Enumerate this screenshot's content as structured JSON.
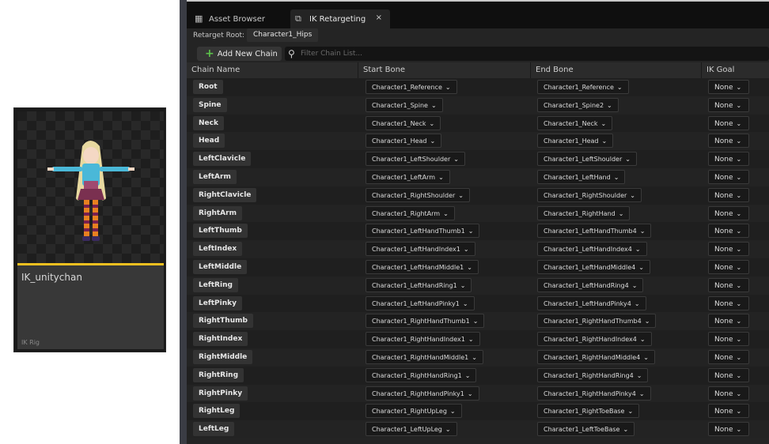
{
  "asset": {
    "name": "IK_unitychan",
    "type": "IK Rig"
  },
  "tabs": [
    {
      "label": "Asset Browser",
      "icon": "folder-icon"
    },
    {
      "label": "IK Retargeting",
      "icon": "retarget-icon",
      "close": "×"
    }
  ],
  "retarget_root": {
    "label": "Retarget Root:",
    "value": "Character1_Hips"
  },
  "toolbar": {
    "add_chain_label": "Add New Chain",
    "search_placeholder": "Filter Chain List..."
  },
  "columns": {
    "name": "Chain Name",
    "start": "Start Bone",
    "end": "End Bone",
    "goal": "IK Goal"
  },
  "chains": [
    {
      "name": "Root",
      "start": "Character1_Reference",
      "end": "Character1_Reference",
      "goal": "None"
    },
    {
      "name": "Spine",
      "start": "Character1_Spine",
      "end": "Character1_Spine2",
      "goal": "None"
    },
    {
      "name": "Neck",
      "start": "Character1_Neck",
      "end": "Character1_Neck",
      "goal": "None"
    },
    {
      "name": "Head",
      "start": "Character1_Head",
      "end": "Character1_Head",
      "goal": "None"
    },
    {
      "name": "LeftClavicle",
      "start": "Character1_LeftShoulder",
      "end": "Character1_LeftShoulder",
      "goal": "None"
    },
    {
      "name": "LeftArm",
      "start": "Character1_LeftArm",
      "end": "Character1_LeftHand",
      "goal": "None"
    },
    {
      "name": "RightClavicle",
      "start": "Character1_RightShoulder",
      "end": "Character1_RightShoulder",
      "goal": "None"
    },
    {
      "name": "RightArm",
      "start": "Character1_RightArm",
      "end": "Character1_RightHand",
      "goal": "None"
    },
    {
      "name": "LeftThumb",
      "start": "Character1_LeftHandThumb1",
      "end": "Character1_LeftHandThumb4",
      "goal": "None"
    },
    {
      "name": "LeftIndex",
      "start": "Character1_LeftHandIndex1",
      "end": "Character1_LeftHandIndex4",
      "goal": "None"
    },
    {
      "name": "LeftMiddle",
      "start": "Character1_LeftHandMiddle1",
      "end": "Character1_LeftHandMiddle4",
      "goal": "None"
    },
    {
      "name": "LeftRing",
      "start": "Character1_LeftHandRing1",
      "end": "Character1_LeftHandRing4",
      "goal": "None"
    },
    {
      "name": "LeftPinky",
      "start": "Character1_LeftHandPinky1",
      "end": "Character1_LeftHandPinky4",
      "goal": "None"
    },
    {
      "name": "RightThumb",
      "start": "Character1_RightHandThumb1",
      "end": "Character1_RightHandThumb4",
      "goal": "None"
    },
    {
      "name": "RightIndex",
      "start": "Character1_RightHandIndex1",
      "end": "Character1_RightHandIndex4",
      "goal": "None"
    },
    {
      "name": "RightMiddle",
      "start": "Character1_RightHandMiddle1",
      "end": "Character1_RightHandMiddle4",
      "goal": "None"
    },
    {
      "name": "RightRing",
      "start": "Character1_RightHandRing1",
      "end": "Character1_RightHandRing4",
      "goal": "None"
    },
    {
      "name": "RightPinky",
      "start": "Character1_RightHandPinky1",
      "end": "Character1_RightHandPinky4",
      "goal": "None"
    },
    {
      "name": "RightLeg",
      "start": "Character1_RightUpLeg",
      "end": "Character1_RightToeBase",
      "goal": "None"
    },
    {
      "name": "LeftLeg",
      "start": "Character1_LeftUpLeg",
      "end": "Character1_LeftToeBase",
      "goal": "None"
    }
  ],
  "colors": {
    "accent_bar": "#f0c020",
    "add_icon": "#5cc24a"
  }
}
